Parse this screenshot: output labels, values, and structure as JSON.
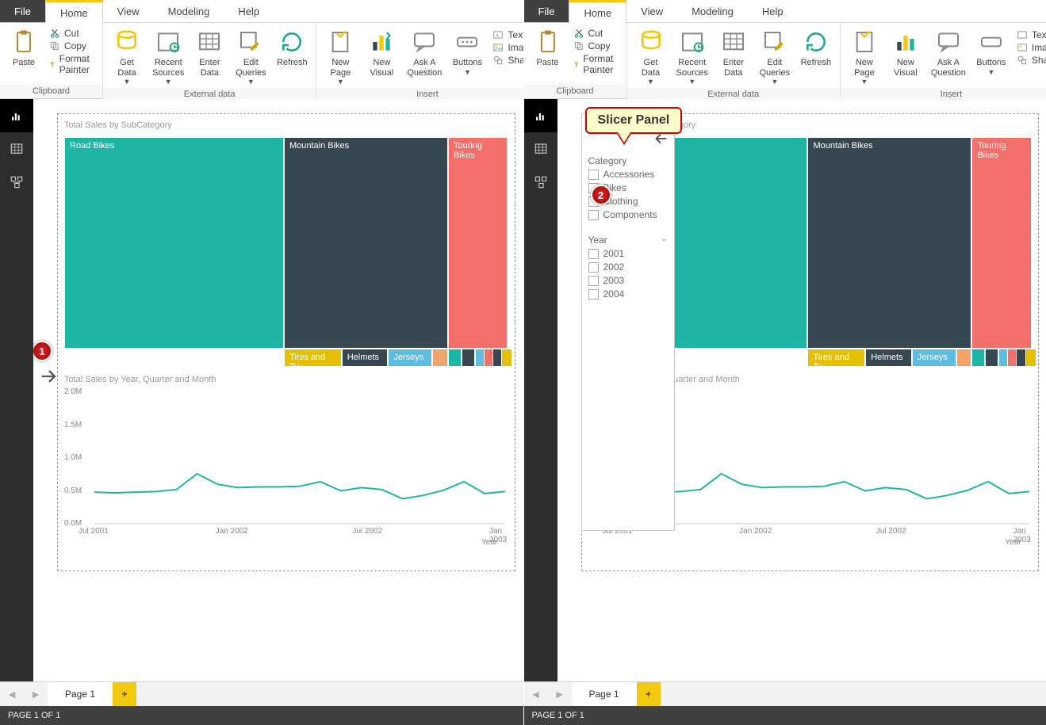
{
  "menu": {
    "file": "File",
    "home": "Home",
    "view": "View",
    "modeling": "Modeling",
    "help": "Help"
  },
  "clipboard": {
    "paste": "Paste",
    "cut": "Cut",
    "copy": "Copy",
    "format_painter": "Format Painter",
    "group_label": "Clipboard"
  },
  "external_data": {
    "get_data": "Get\nData",
    "recent_sources": "Recent\nSources",
    "enter_data": "Enter\nData",
    "edit_queries": "Edit\nQueries",
    "refresh": "Refresh",
    "group_label": "External data"
  },
  "insert": {
    "new_page": "New\nPage",
    "new_visual": "New\nVisual",
    "ask": "Ask A\nQuestion",
    "buttons": "Buttons",
    "text": "Text",
    "image": "Ima",
    "shapes": "Shap",
    "group_label": "Insert"
  },
  "page_tabs": {
    "page1": "Page 1",
    "add": "+"
  },
  "status": {
    "text": "PAGE 1 OF 1"
  },
  "callout": {
    "one": "1",
    "two": "2",
    "label": "Slicer Panel"
  },
  "slicer": {
    "cat_title": "Category",
    "categories": [
      "Accessories",
      "Bikes",
      "Clothing",
      "Components"
    ],
    "year_title": "Year",
    "years": [
      "2001",
      "2002",
      "2003",
      "2004"
    ]
  },
  "chart_data": [
    {
      "type": "treemap",
      "title": "Total Sales by SubCategory",
      "items": [
        {
          "label": "Road Bikes",
          "color": "#1fb5a5",
          "x": 0,
          "y": 0,
          "w": 49.5,
          "h": 92
        },
        {
          "label": "Mountain Bikes",
          "color": "#37474f",
          "x": 49.5,
          "y": 0,
          "w": 37,
          "h": 92
        },
        {
          "label": "Touring Bikes",
          "color": "#f36f6a",
          "x": 86.5,
          "y": 0,
          "w": 13.5,
          "h": 92
        },
        {
          "label": "Tires and Tu...",
          "color": "#e5c000",
          "x": 49.5,
          "y": 92,
          "w": 13,
          "h": 8
        },
        {
          "label": "Helmets",
          "color": "#37474f",
          "x": 62.5,
          "y": 92,
          "w": 10.5,
          "h": 8
        },
        {
          "label": "Jerseys",
          "color": "#5cbde0",
          "x": 73,
          "y": 92,
          "w": 10,
          "h": 8
        },
        {
          "label": "",
          "color": "#f3a26a",
          "x": 83,
          "y": 92,
          "w": 3.5,
          "h": 8
        },
        {
          "label": "",
          "color": "#1fb5a5",
          "x": 86.5,
          "y": 92,
          "w": 3,
          "h": 8
        },
        {
          "label": "",
          "color": "#37474f",
          "x": 89.5,
          "y": 92,
          "w": 3,
          "h": 8
        },
        {
          "label": "",
          "color": "#5cbde0",
          "x": 92.5,
          "y": 92,
          "w": 2,
          "h": 8
        },
        {
          "label": "",
          "color": "#f36f6a",
          "x": 94.5,
          "y": 92,
          "w": 2,
          "h": 8
        },
        {
          "label": "",
          "color": "#37474f",
          "x": 96.5,
          "y": 92,
          "w": 2,
          "h": 8
        },
        {
          "label": "",
          "color": "#e5c000",
          "x": 98.5,
          "y": 92,
          "w": 1.5,
          "h": 8
        }
      ]
    },
    {
      "type": "line",
      "title": "Total Sales by Year, Quarter and Month",
      "xlabel": "Year",
      "ylabel": "",
      "ylim": [
        0,
        2000000
      ],
      "yticks": [
        "0.0M",
        "0.5M",
        "1.0M",
        "1.5M",
        "2.0M"
      ],
      "xticks": [
        "Jul 2001",
        "Jan 2002",
        "Jul 2002",
        "Jan 2003"
      ],
      "x": [
        "Jul 2001",
        "Aug 2001",
        "Sep 2001",
        "Oct 2001",
        "Nov 2001",
        "Dec 2001",
        "Jan 2002",
        "Feb 2002",
        "Mar 2002",
        "Apr 2002",
        "May 2002",
        "Jun 2002",
        "Jul 2002",
        "Aug 2002",
        "Sep 2002",
        "Oct 2002",
        "Nov 2002",
        "Dec 2002",
        "Jan 2003",
        "Feb 2003",
        "Mar 2003"
      ],
      "values": [
        480000,
        470000,
        480000,
        490000,
        520000,
        760000,
        600000,
        550000,
        560000,
        560000,
        570000,
        640000,
        500000,
        550000,
        520000,
        380000,
        430000,
        510000,
        640000,
        460000,
        490000
      ],
      "color": "#1fb5a5"
    }
  ]
}
